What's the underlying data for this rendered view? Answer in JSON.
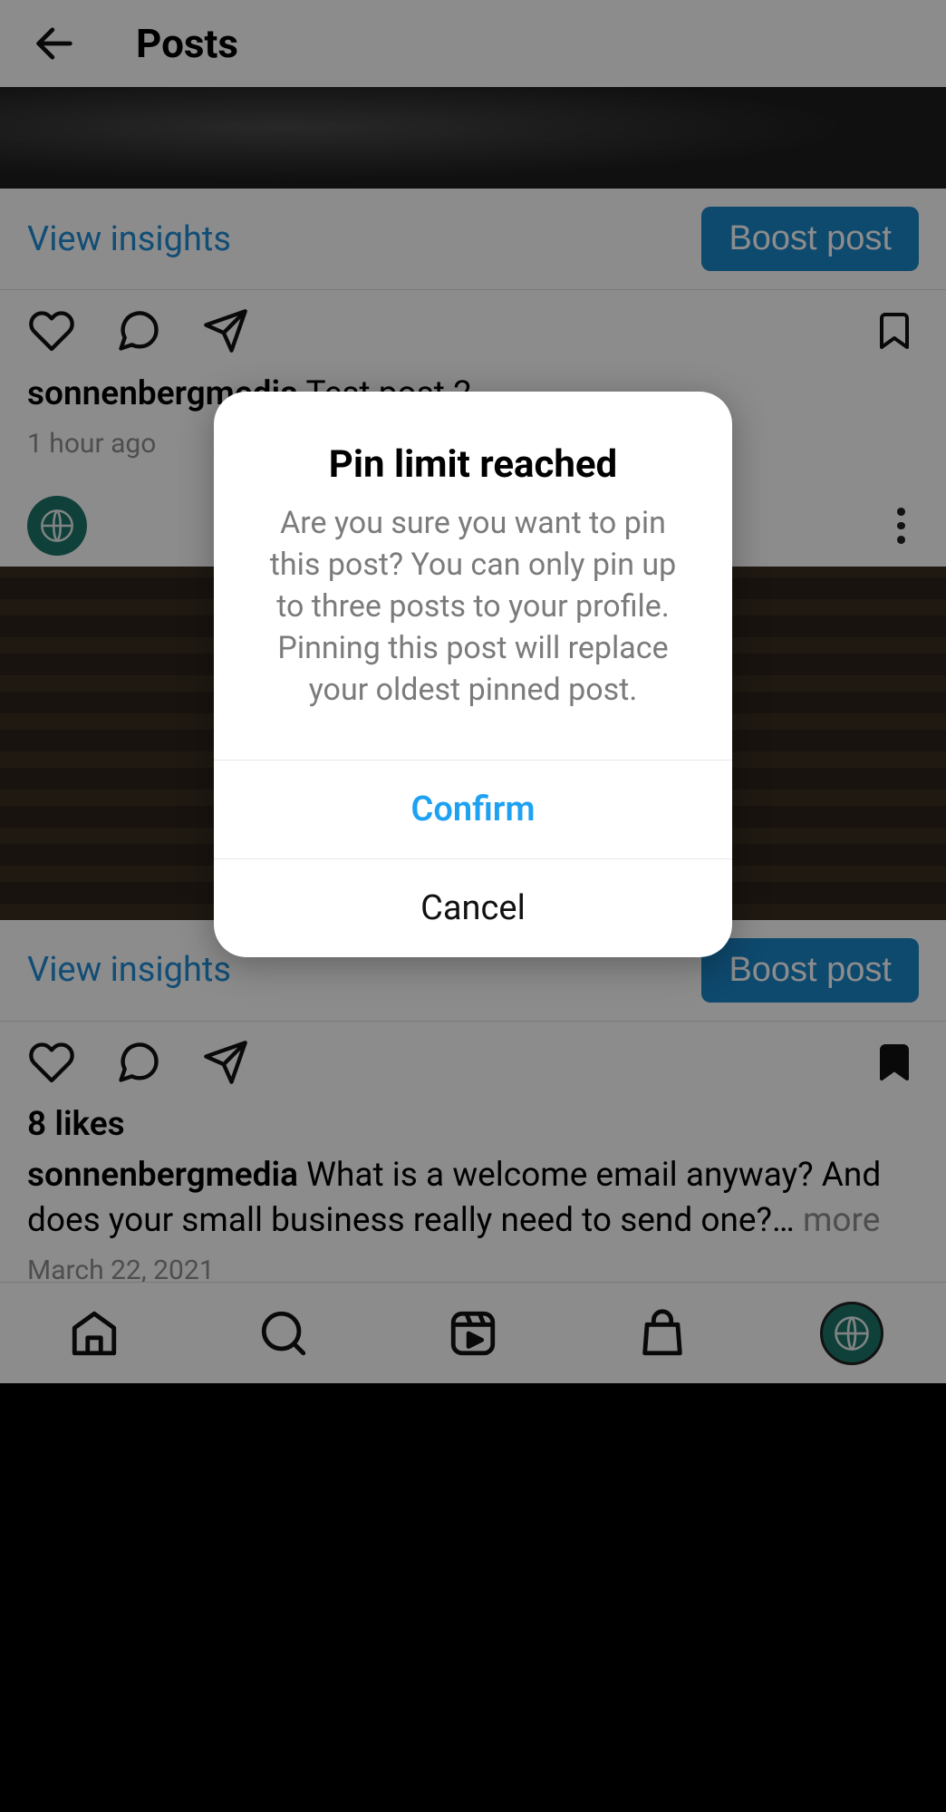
{
  "header": {
    "title": "Posts"
  },
  "posts": [
    {
      "insights_link": "View insights",
      "boost_label": "Boost post",
      "username": "sonnenbergmedia",
      "caption": "Test post 2",
      "time": "1 hour ago"
    },
    {
      "insights_link": "View insights",
      "boost_label": "Boost post",
      "likes": "8 likes",
      "username": "sonnenbergmedia",
      "caption": "What is a welcome email anyway? And does your small business really need to send one?…",
      "more": " more",
      "time": "March 22, 2021"
    }
  ],
  "dialog": {
    "title": "Pin limit reached",
    "body": "Are you sure you want to pin this post? You can only pin up to three posts to your profile. Pinning this post will replace your oldest pinned post.",
    "confirm": "Confirm",
    "cancel": "Cancel"
  }
}
